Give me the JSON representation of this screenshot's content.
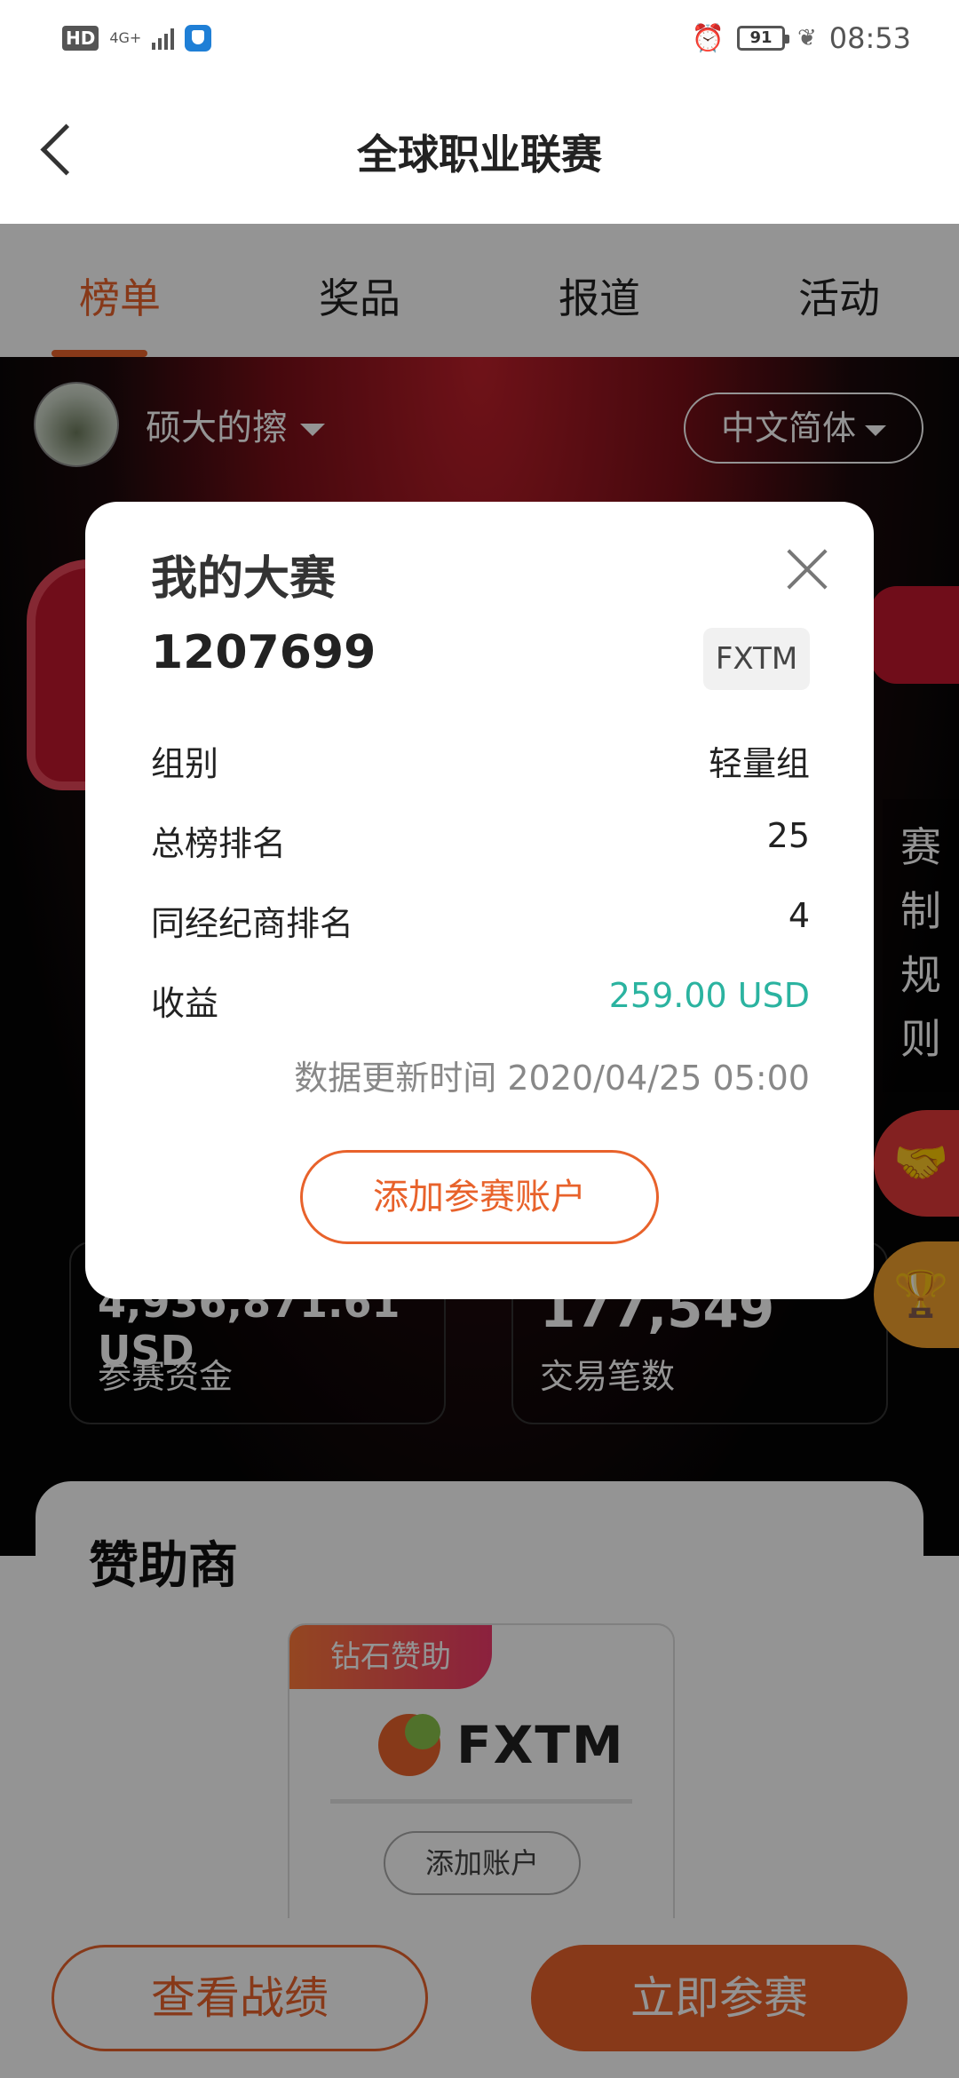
{
  "status_bar": {
    "hd": "HD",
    "network": "4G+",
    "battery": "91",
    "time": "08:53"
  },
  "header": {
    "title": "全球职业联赛"
  },
  "tabs": [
    {
      "label": "榜单",
      "active": true
    },
    {
      "label": "奖品",
      "active": false
    },
    {
      "label": "报道",
      "active": false
    },
    {
      "label": "活动",
      "active": false
    }
  ],
  "user": {
    "name": "硕大的擦"
  },
  "language": {
    "selected": "中文简体"
  },
  "stats": [
    {
      "value": "4,936,871.61 USD",
      "label": "参赛资金"
    },
    {
      "value": "177,549",
      "label": "交易笔数"
    }
  ],
  "side": {
    "rules": [
      "赛",
      "制",
      "规",
      "则"
    ]
  },
  "sponsor": {
    "title": "赞助商",
    "tag": "钻石赞助",
    "brand": "FXTM",
    "add_account": "添加账户"
  },
  "bottom": {
    "view_record": "查看战绩",
    "join_now": "立即参赛"
  },
  "modal": {
    "title": "我的大赛",
    "account_id": "1207699",
    "broker": "FXTM",
    "rows": [
      {
        "label": "组别",
        "value": "轻量组"
      },
      {
        "label": "总榜排名",
        "value": "25"
      },
      {
        "label": "同经纪商排名",
        "value": "4"
      },
      {
        "label": "收益",
        "value": "259.00 USD"
      }
    ],
    "update_time": "数据更新时间 2020/04/25 05:00",
    "add_button": "添加参赛账户"
  },
  "colors": {
    "accent": "#e8622b",
    "profit": "#2bb3a0"
  }
}
